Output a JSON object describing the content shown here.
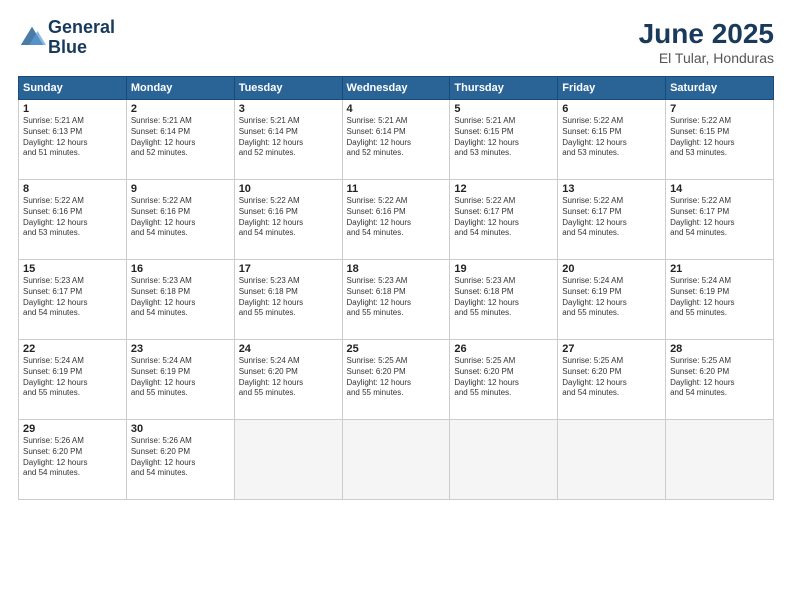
{
  "header": {
    "logo_line1": "General",
    "logo_line2": "Blue",
    "month_title": "June 2025",
    "location": "El Tular, Honduras"
  },
  "weekdays": [
    "Sunday",
    "Monday",
    "Tuesday",
    "Wednesday",
    "Thursday",
    "Friday",
    "Saturday"
  ],
  "rows": [
    [
      {
        "day": "1",
        "lines": [
          "Sunrise: 5:21 AM",
          "Sunset: 6:13 PM",
          "Daylight: 12 hours",
          "and 51 minutes."
        ]
      },
      {
        "day": "2",
        "lines": [
          "Sunrise: 5:21 AM",
          "Sunset: 6:14 PM",
          "Daylight: 12 hours",
          "and 52 minutes."
        ]
      },
      {
        "day": "3",
        "lines": [
          "Sunrise: 5:21 AM",
          "Sunset: 6:14 PM",
          "Daylight: 12 hours",
          "and 52 minutes."
        ]
      },
      {
        "day": "4",
        "lines": [
          "Sunrise: 5:21 AM",
          "Sunset: 6:14 PM",
          "Daylight: 12 hours",
          "and 52 minutes."
        ]
      },
      {
        "day": "5",
        "lines": [
          "Sunrise: 5:21 AM",
          "Sunset: 6:15 PM",
          "Daylight: 12 hours",
          "and 53 minutes."
        ]
      },
      {
        "day": "6",
        "lines": [
          "Sunrise: 5:22 AM",
          "Sunset: 6:15 PM",
          "Daylight: 12 hours",
          "and 53 minutes."
        ]
      },
      {
        "day": "7",
        "lines": [
          "Sunrise: 5:22 AM",
          "Sunset: 6:15 PM",
          "Daylight: 12 hours",
          "and 53 minutes."
        ]
      }
    ],
    [
      {
        "day": "8",
        "lines": [
          "Sunrise: 5:22 AM",
          "Sunset: 6:16 PM",
          "Daylight: 12 hours",
          "and 53 minutes."
        ]
      },
      {
        "day": "9",
        "lines": [
          "Sunrise: 5:22 AM",
          "Sunset: 6:16 PM",
          "Daylight: 12 hours",
          "and 54 minutes."
        ]
      },
      {
        "day": "10",
        "lines": [
          "Sunrise: 5:22 AM",
          "Sunset: 6:16 PM",
          "Daylight: 12 hours",
          "and 54 minutes."
        ]
      },
      {
        "day": "11",
        "lines": [
          "Sunrise: 5:22 AM",
          "Sunset: 6:16 PM",
          "Daylight: 12 hours",
          "and 54 minutes."
        ]
      },
      {
        "day": "12",
        "lines": [
          "Sunrise: 5:22 AM",
          "Sunset: 6:17 PM",
          "Daylight: 12 hours",
          "and 54 minutes."
        ]
      },
      {
        "day": "13",
        "lines": [
          "Sunrise: 5:22 AM",
          "Sunset: 6:17 PM",
          "Daylight: 12 hours",
          "and 54 minutes."
        ]
      },
      {
        "day": "14",
        "lines": [
          "Sunrise: 5:22 AM",
          "Sunset: 6:17 PM",
          "Daylight: 12 hours",
          "and 54 minutes."
        ]
      }
    ],
    [
      {
        "day": "15",
        "lines": [
          "Sunrise: 5:23 AM",
          "Sunset: 6:17 PM",
          "Daylight: 12 hours",
          "and 54 minutes."
        ]
      },
      {
        "day": "16",
        "lines": [
          "Sunrise: 5:23 AM",
          "Sunset: 6:18 PM",
          "Daylight: 12 hours",
          "and 54 minutes."
        ]
      },
      {
        "day": "17",
        "lines": [
          "Sunrise: 5:23 AM",
          "Sunset: 6:18 PM",
          "Daylight: 12 hours",
          "and 55 minutes."
        ]
      },
      {
        "day": "18",
        "lines": [
          "Sunrise: 5:23 AM",
          "Sunset: 6:18 PM",
          "Daylight: 12 hours",
          "and 55 minutes."
        ]
      },
      {
        "day": "19",
        "lines": [
          "Sunrise: 5:23 AM",
          "Sunset: 6:18 PM",
          "Daylight: 12 hours",
          "and 55 minutes."
        ]
      },
      {
        "day": "20",
        "lines": [
          "Sunrise: 5:24 AM",
          "Sunset: 6:19 PM",
          "Daylight: 12 hours",
          "and 55 minutes."
        ]
      },
      {
        "day": "21",
        "lines": [
          "Sunrise: 5:24 AM",
          "Sunset: 6:19 PM",
          "Daylight: 12 hours",
          "and 55 minutes."
        ]
      }
    ],
    [
      {
        "day": "22",
        "lines": [
          "Sunrise: 5:24 AM",
          "Sunset: 6:19 PM",
          "Daylight: 12 hours",
          "and 55 minutes."
        ]
      },
      {
        "day": "23",
        "lines": [
          "Sunrise: 5:24 AM",
          "Sunset: 6:19 PM",
          "Daylight: 12 hours",
          "and 55 minutes."
        ]
      },
      {
        "day": "24",
        "lines": [
          "Sunrise: 5:24 AM",
          "Sunset: 6:20 PM",
          "Daylight: 12 hours",
          "and 55 minutes."
        ]
      },
      {
        "day": "25",
        "lines": [
          "Sunrise: 5:25 AM",
          "Sunset: 6:20 PM",
          "Daylight: 12 hours",
          "and 55 minutes."
        ]
      },
      {
        "day": "26",
        "lines": [
          "Sunrise: 5:25 AM",
          "Sunset: 6:20 PM",
          "Daylight: 12 hours",
          "and 55 minutes."
        ]
      },
      {
        "day": "27",
        "lines": [
          "Sunrise: 5:25 AM",
          "Sunset: 6:20 PM",
          "Daylight: 12 hours",
          "and 54 minutes."
        ]
      },
      {
        "day": "28",
        "lines": [
          "Sunrise: 5:25 AM",
          "Sunset: 6:20 PM",
          "Daylight: 12 hours",
          "and 54 minutes."
        ]
      }
    ],
    [
      {
        "day": "29",
        "lines": [
          "Sunrise: 5:26 AM",
          "Sunset: 6:20 PM",
          "Daylight: 12 hours",
          "and 54 minutes."
        ]
      },
      {
        "day": "30",
        "lines": [
          "Sunrise: 5:26 AM",
          "Sunset: 6:20 PM",
          "Daylight: 12 hours",
          "and 54 minutes."
        ]
      },
      {
        "day": "",
        "lines": []
      },
      {
        "day": "",
        "lines": []
      },
      {
        "day": "",
        "lines": []
      },
      {
        "day": "",
        "lines": []
      },
      {
        "day": "",
        "lines": []
      }
    ]
  ]
}
